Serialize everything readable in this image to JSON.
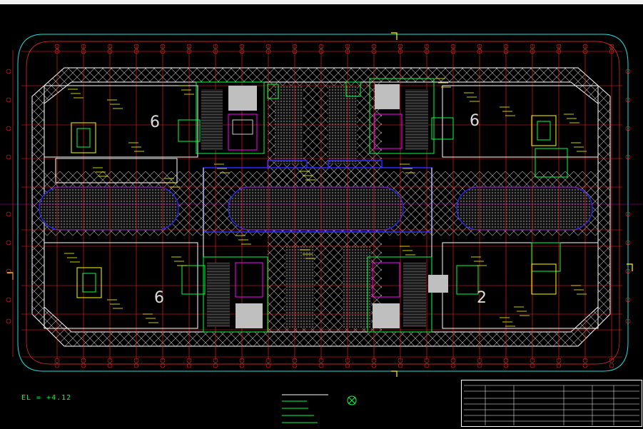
{
  "drawing": {
    "elevation_label": "EL = +4.12",
    "zone_numbers": [
      "6",
      "6",
      "6",
      "2"
    ]
  },
  "colors": {
    "background": "#000000",
    "grid_lines": "#ff2020",
    "walls": "#ffffff",
    "boundary": "#20e0e0",
    "hatching": "#c8c8c8",
    "zones": "#2020ff",
    "cores": "#00ff40",
    "annotations": "#ffff00",
    "stair_cores": "#ff00ff"
  }
}
